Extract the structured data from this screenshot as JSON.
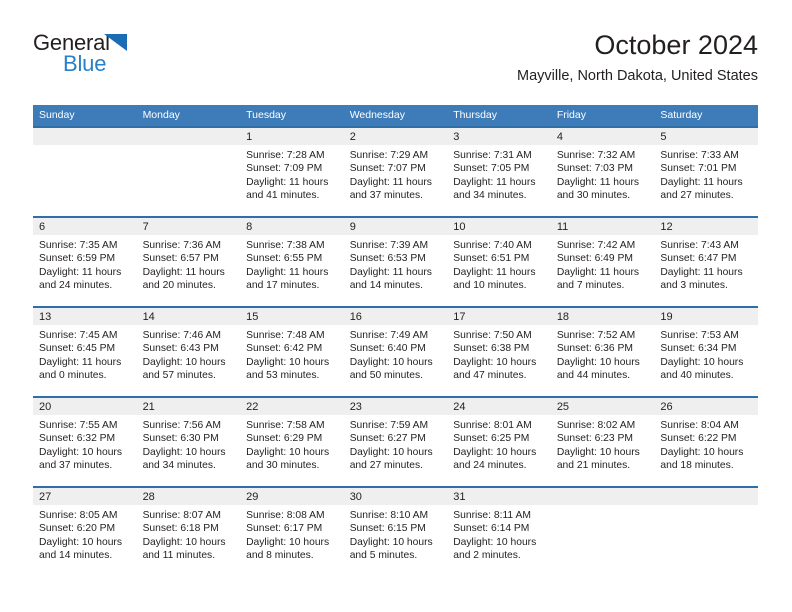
{
  "brand": {
    "name_part1": "General",
    "name_part2": "Blue"
  },
  "header": {
    "title": "October 2024",
    "subtitle": "Mayville, North Dakota, United States"
  },
  "colors": {
    "header_blue": "#3d7cb8",
    "row_divider_blue": "#2f6fa8",
    "daynum_band": "#efefef",
    "brand_blue": "#2a7fc9",
    "text": "#231f20"
  },
  "weekdays": [
    "Sunday",
    "Monday",
    "Tuesday",
    "Wednesday",
    "Thursday",
    "Friday",
    "Saturday"
  ],
  "weeks": [
    [
      {
        "empty": true
      },
      {
        "empty": true
      },
      {
        "day": "1",
        "sunrise": "Sunrise: 7:28 AM",
        "sunset": "Sunset: 7:09 PM",
        "daylight": "Daylight: 11 hours and 41 minutes."
      },
      {
        "day": "2",
        "sunrise": "Sunrise: 7:29 AM",
        "sunset": "Sunset: 7:07 PM",
        "daylight": "Daylight: 11 hours and 37 minutes."
      },
      {
        "day": "3",
        "sunrise": "Sunrise: 7:31 AM",
        "sunset": "Sunset: 7:05 PM",
        "daylight": "Daylight: 11 hours and 34 minutes."
      },
      {
        "day": "4",
        "sunrise": "Sunrise: 7:32 AM",
        "sunset": "Sunset: 7:03 PM",
        "daylight": "Daylight: 11 hours and 30 minutes."
      },
      {
        "day": "5",
        "sunrise": "Sunrise: 7:33 AM",
        "sunset": "Sunset: 7:01 PM",
        "daylight": "Daylight: 11 hours and 27 minutes."
      }
    ],
    [
      {
        "day": "6",
        "sunrise": "Sunrise: 7:35 AM",
        "sunset": "Sunset: 6:59 PM",
        "daylight": "Daylight: 11 hours and 24 minutes."
      },
      {
        "day": "7",
        "sunrise": "Sunrise: 7:36 AM",
        "sunset": "Sunset: 6:57 PM",
        "daylight": "Daylight: 11 hours and 20 minutes."
      },
      {
        "day": "8",
        "sunrise": "Sunrise: 7:38 AM",
        "sunset": "Sunset: 6:55 PM",
        "daylight": "Daylight: 11 hours and 17 minutes."
      },
      {
        "day": "9",
        "sunrise": "Sunrise: 7:39 AM",
        "sunset": "Sunset: 6:53 PM",
        "daylight": "Daylight: 11 hours and 14 minutes."
      },
      {
        "day": "10",
        "sunrise": "Sunrise: 7:40 AM",
        "sunset": "Sunset: 6:51 PM",
        "daylight": "Daylight: 11 hours and 10 minutes."
      },
      {
        "day": "11",
        "sunrise": "Sunrise: 7:42 AM",
        "sunset": "Sunset: 6:49 PM",
        "daylight": "Daylight: 11 hours and 7 minutes."
      },
      {
        "day": "12",
        "sunrise": "Sunrise: 7:43 AM",
        "sunset": "Sunset: 6:47 PM",
        "daylight": "Daylight: 11 hours and 3 minutes."
      }
    ],
    [
      {
        "day": "13",
        "sunrise": "Sunrise: 7:45 AM",
        "sunset": "Sunset: 6:45 PM",
        "daylight": "Daylight: 11 hours and 0 minutes."
      },
      {
        "day": "14",
        "sunrise": "Sunrise: 7:46 AM",
        "sunset": "Sunset: 6:43 PM",
        "daylight": "Daylight: 10 hours and 57 minutes."
      },
      {
        "day": "15",
        "sunrise": "Sunrise: 7:48 AM",
        "sunset": "Sunset: 6:42 PM",
        "daylight": "Daylight: 10 hours and 53 minutes."
      },
      {
        "day": "16",
        "sunrise": "Sunrise: 7:49 AM",
        "sunset": "Sunset: 6:40 PM",
        "daylight": "Daylight: 10 hours and 50 minutes."
      },
      {
        "day": "17",
        "sunrise": "Sunrise: 7:50 AM",
        "sunset": "Sunset: 6:38 PM",
        "daylight": "Daylight: 10 hours and 47 minutes."
      },
      {
        "day": "18",
        "sunrise": "Sunrise: 7:52 AM",
        "sunset": "Sunset: 6:36 PM",
        "daylight": "Daylight: 10 hours and 44 minutes."
      },
      {
        "day": "19",
        "sunrise": "Sunrise: 7:53 AM",
        "sunset": "Sunset: 6:34 PM",
        "daylight": "Daylight: 10 hours and 40 minutes."
      }
    ],
    [
      {
        "day": "20",
        "sunrise": "Sunrise: 7:55 AM",
        "sunset": "Sunset: 6:32 PM",
        "daylight": "Daylight: 10 hours and 37 minutes."
      },
      {
        "day": "21",
        "sunrise": "Sunrise: 7:56 AM",
        "sunset": "Sunset: 6:30 PM",
        "daylight": "Daylight: 10 hours and 34 minutes."
      },
      {
        "day": "22",
        "sunrise": "Sunrise: 7:58 AM",
        "sunset": "Sunset: 6:29 PM",
        "daylight": "Daylight: 10 hours and 30 minutes."
      },
      {
        "day": "23",
        "sunrise": "Sunrise: 7:59 AM",
        "sunset": "Sunset: 6:27 PM",
        "daylight": "Daylight: 10 hours and 27 minutes."
      },
      {
        "day": "24",
        "sunrise": "Sunrise: 8:01 AM",
        "sunset": "Sunset: 6:25 PM",
        "daylight": "Daylight: 10 hours and 24 minutes."
      },
      {
        "day": "25",
        "sunrise": "Sunrise: 8:02 AM",
        "sunset": "Sunset: 6:23 PM",
        "daylight": "Daylight: 10 hours and 21 minutes."
      },
      {
        "day": "26",
        "sunrise": "Sunrise: 8:04 AM",
        "sunset": "Sunset: 6:22 PM",
        "daylight": "Daylight: 10 hours and 18 minutes."
      }
    ],
    [
      {
        "day": "27",
        "sunrise": "Sunrise: 8:05 AM",
        "sunset": "Sunset: 6:20 PM",
        "daylight": "Daylight: 10 hours and 14 minutes."
      },
      {
        "day": "28",
        "sunrise": "Sunrise: 8:07 AM",
        "sunset": "Sunset: 6:18 PM",
        "daylight": "Daylight: 10 hours and 11 minutes."
      },
      {
        "day": "29",
        "sunrise": "Sunrise: 8:08 AM",
        "sunset": "Sunset: 6:17 PM",
        "daylight": "Daylight: 10 hours and 8 minutes."
      },
      {
        "day": "30",
        "sunrise": "Sunrise: 8:10 AM",
        "sunset": "Sunset: 6:15 PM",
        "daylight": "Daylight: 10 hours and 5 minutes."
      },
      {
        "day": "31",
        "sunrise": "Sunrise: 8:11 AM",
        "sunset": "Sunset: 6:14 PM",
        "daylight": "Daylight: 10 hours and 2 minutes."
      },
      {
        "empty": true
      },
      {
        "empty": true
      }
    ]
  ]
}
